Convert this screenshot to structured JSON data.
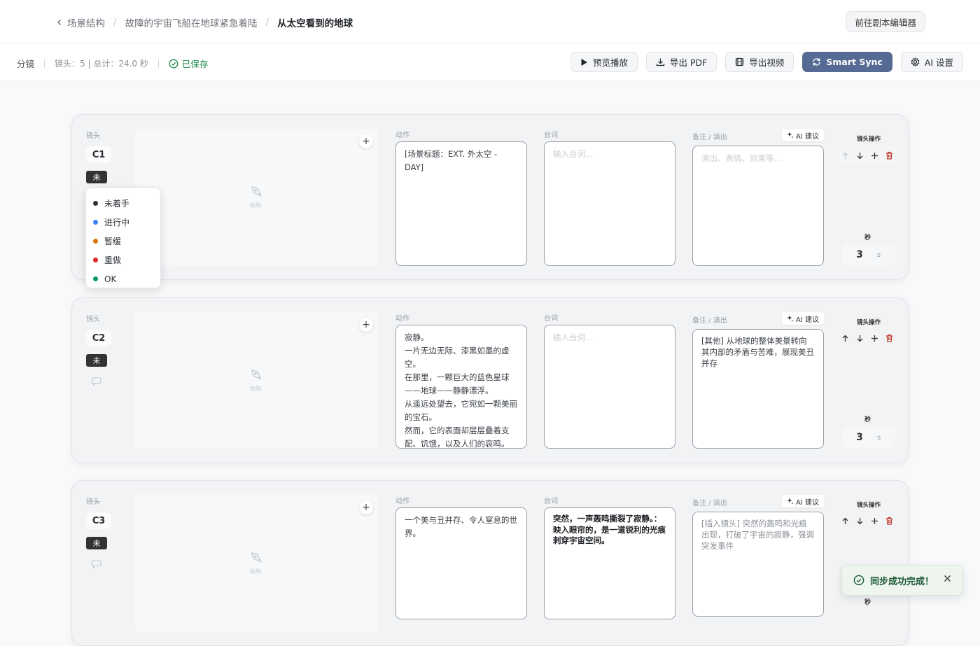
{
  "breadcrumb": {
    "items": [
      "场景结构",
      "故障的宇宙飞船在地球紧急着陆",
      "从太空看到的地球"
    ],
    "separator": "/"
  },
  "header": {
    "editor_button": "前往剧本编辑器"
  },
  "toolbar": {
    "section_label": "分镜",
    "stats": "镜头：5 | 总计：24.0 秒",
    "saved": "已保存",
    "buttons": {
      "preview": "预览播放",
      "export_pdf": "导出 PDF",
      "export_video": "导出视频",
      "smart_sync": "Smart Sync",
      "ai_settings": "AI 设置"
    }
  },
  "labels": {
    "shot": "镜头",
    "draw": "绘制",
    "action": "动作",
    "dialogue": "台词",
    "notes": "备注 / 演出",
    "ai_suggest": "AI 建议",
    "ops": "镜头操作",
    "seconds": "秒",
    "unit": "s",
    "dialogue_placeholder": "输入台词...",
    "notes_placeholder": "演出、表情、效果等..."
  },
  "shots": [
    {
      "code": "C1",
      "status": "未",
      "action": "[场景标题：EXT. 外太空 - DAY]",
      "dialogue": "",
      "notes": "",
      "duration": "3"
    },
    {
      "code": "C2",
      "status": "未",
      "action": "寂静。\n一片无边无际、漆黑如墨的虚空。\n在那里，一颗巨大的蓝色星球——地球——静静漂浮。\n从遥远处望去，它宛如一颗美丽的宝石。\n然而，它的表面却层层叠着支配、饥饿，以及人们的哀鸣。",
      "dialogue": "",
      "notes": "[其他] 从地球的整体美景转向其内部的矛盾与苦难，展现美丑并存",
      "duration": "3"
    },
    {
      "code": "C3",
      "status": "未",
      "action": "一个美与丑并存、令人窒息的世界。",
      "dialogue": "突然，一声轰鸣撕裂了寂静。：映入眼帘的，是一道锐利的光痕刺穿宇宙空间。",
      "notes": "[插入镜头] 突然的轰鸣和光痕出现，打破了宇宙的寂静，强调突发事件",
      "duration": ""
    }
  ],
  "status_menu": {
    "items": [
      {
        "label": "未着手",
        "color": "#333333"
      },
      {
        "label": "进行中",
        "color": "#3b82f6"
      },
      {
        "label": "暂缓",
        "color": "#d97706"
      },
      {
        "label": "重做",
        "color": "#dc2626"
      },
      {
        "label": "OK",
        "color": "#059669"
      }
    ]
  },
  "toast": {
    "message": "同步成功完成！"
  },
  "colors": {
    "primary": "#566b93",
    "saved": "#1f8a4c",
    "delete": "#c0392b"
  }
}
